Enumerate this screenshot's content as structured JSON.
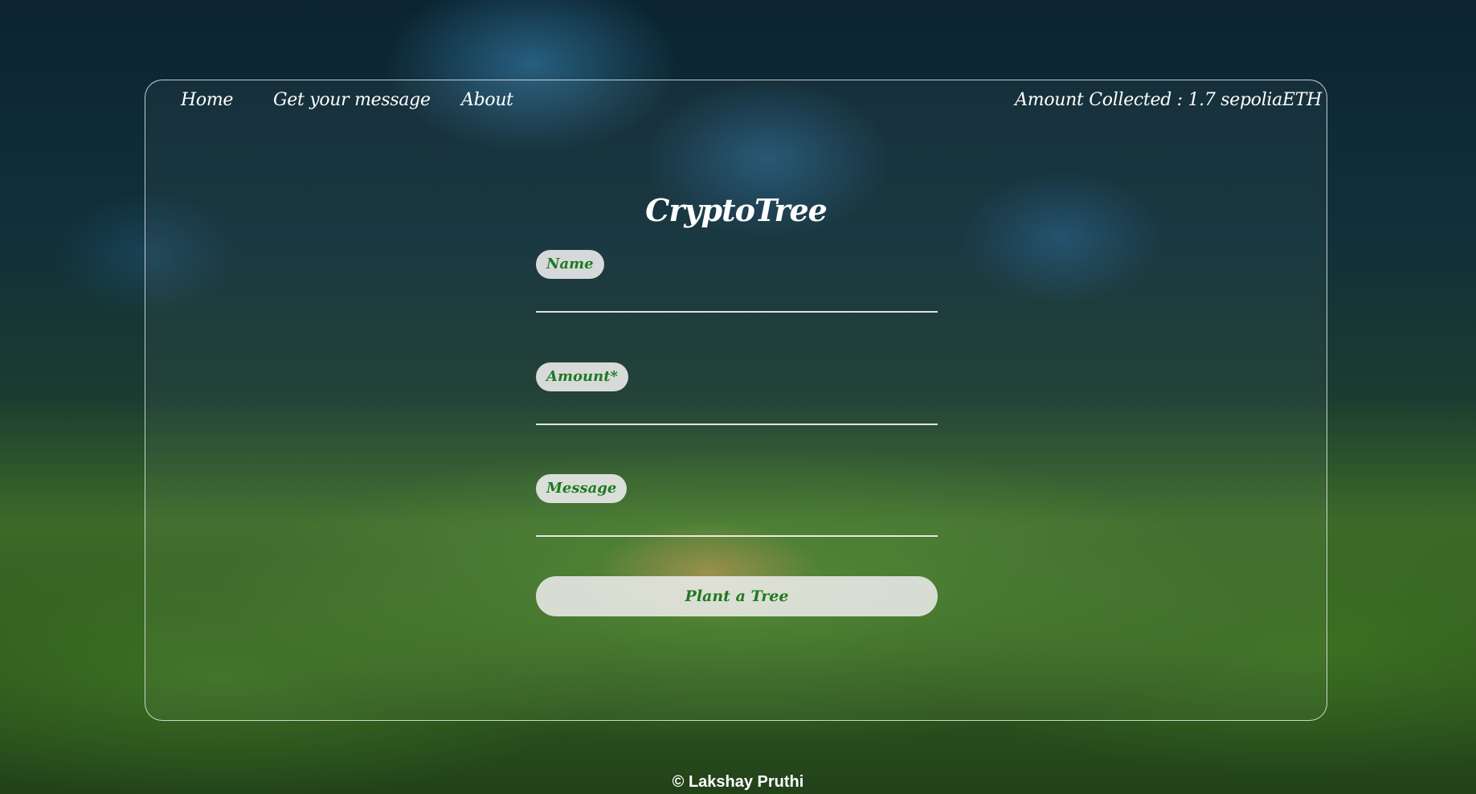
{
  "nav": {
    "items": [
      {
        "label": "Home"
      },
      {
        "label": "Get your message"
      },
      {
        "label": "About"
      }
    ],
    "amount_collected": "Amount Collected : 1.7 sepoliaETH"
  },
  "app": {
    "title": "CryptoTree"
  },
  "form": {
    "name_label": "Name",
    "name_value": "",
    "amount_label": "Amount*",
    "amount_value": "",
    "message_label": "Message",
    "message_value": "",
    "submit_label": "Plant a Tree"
  },
  "footer": {
    "text": "© Lakshay Pruthi"
  },
  "colors": {
    "accent_green": "#1e7a22",
    "text": "#ffffff",
    "pill_background": "#ebebeb"
  }
}
